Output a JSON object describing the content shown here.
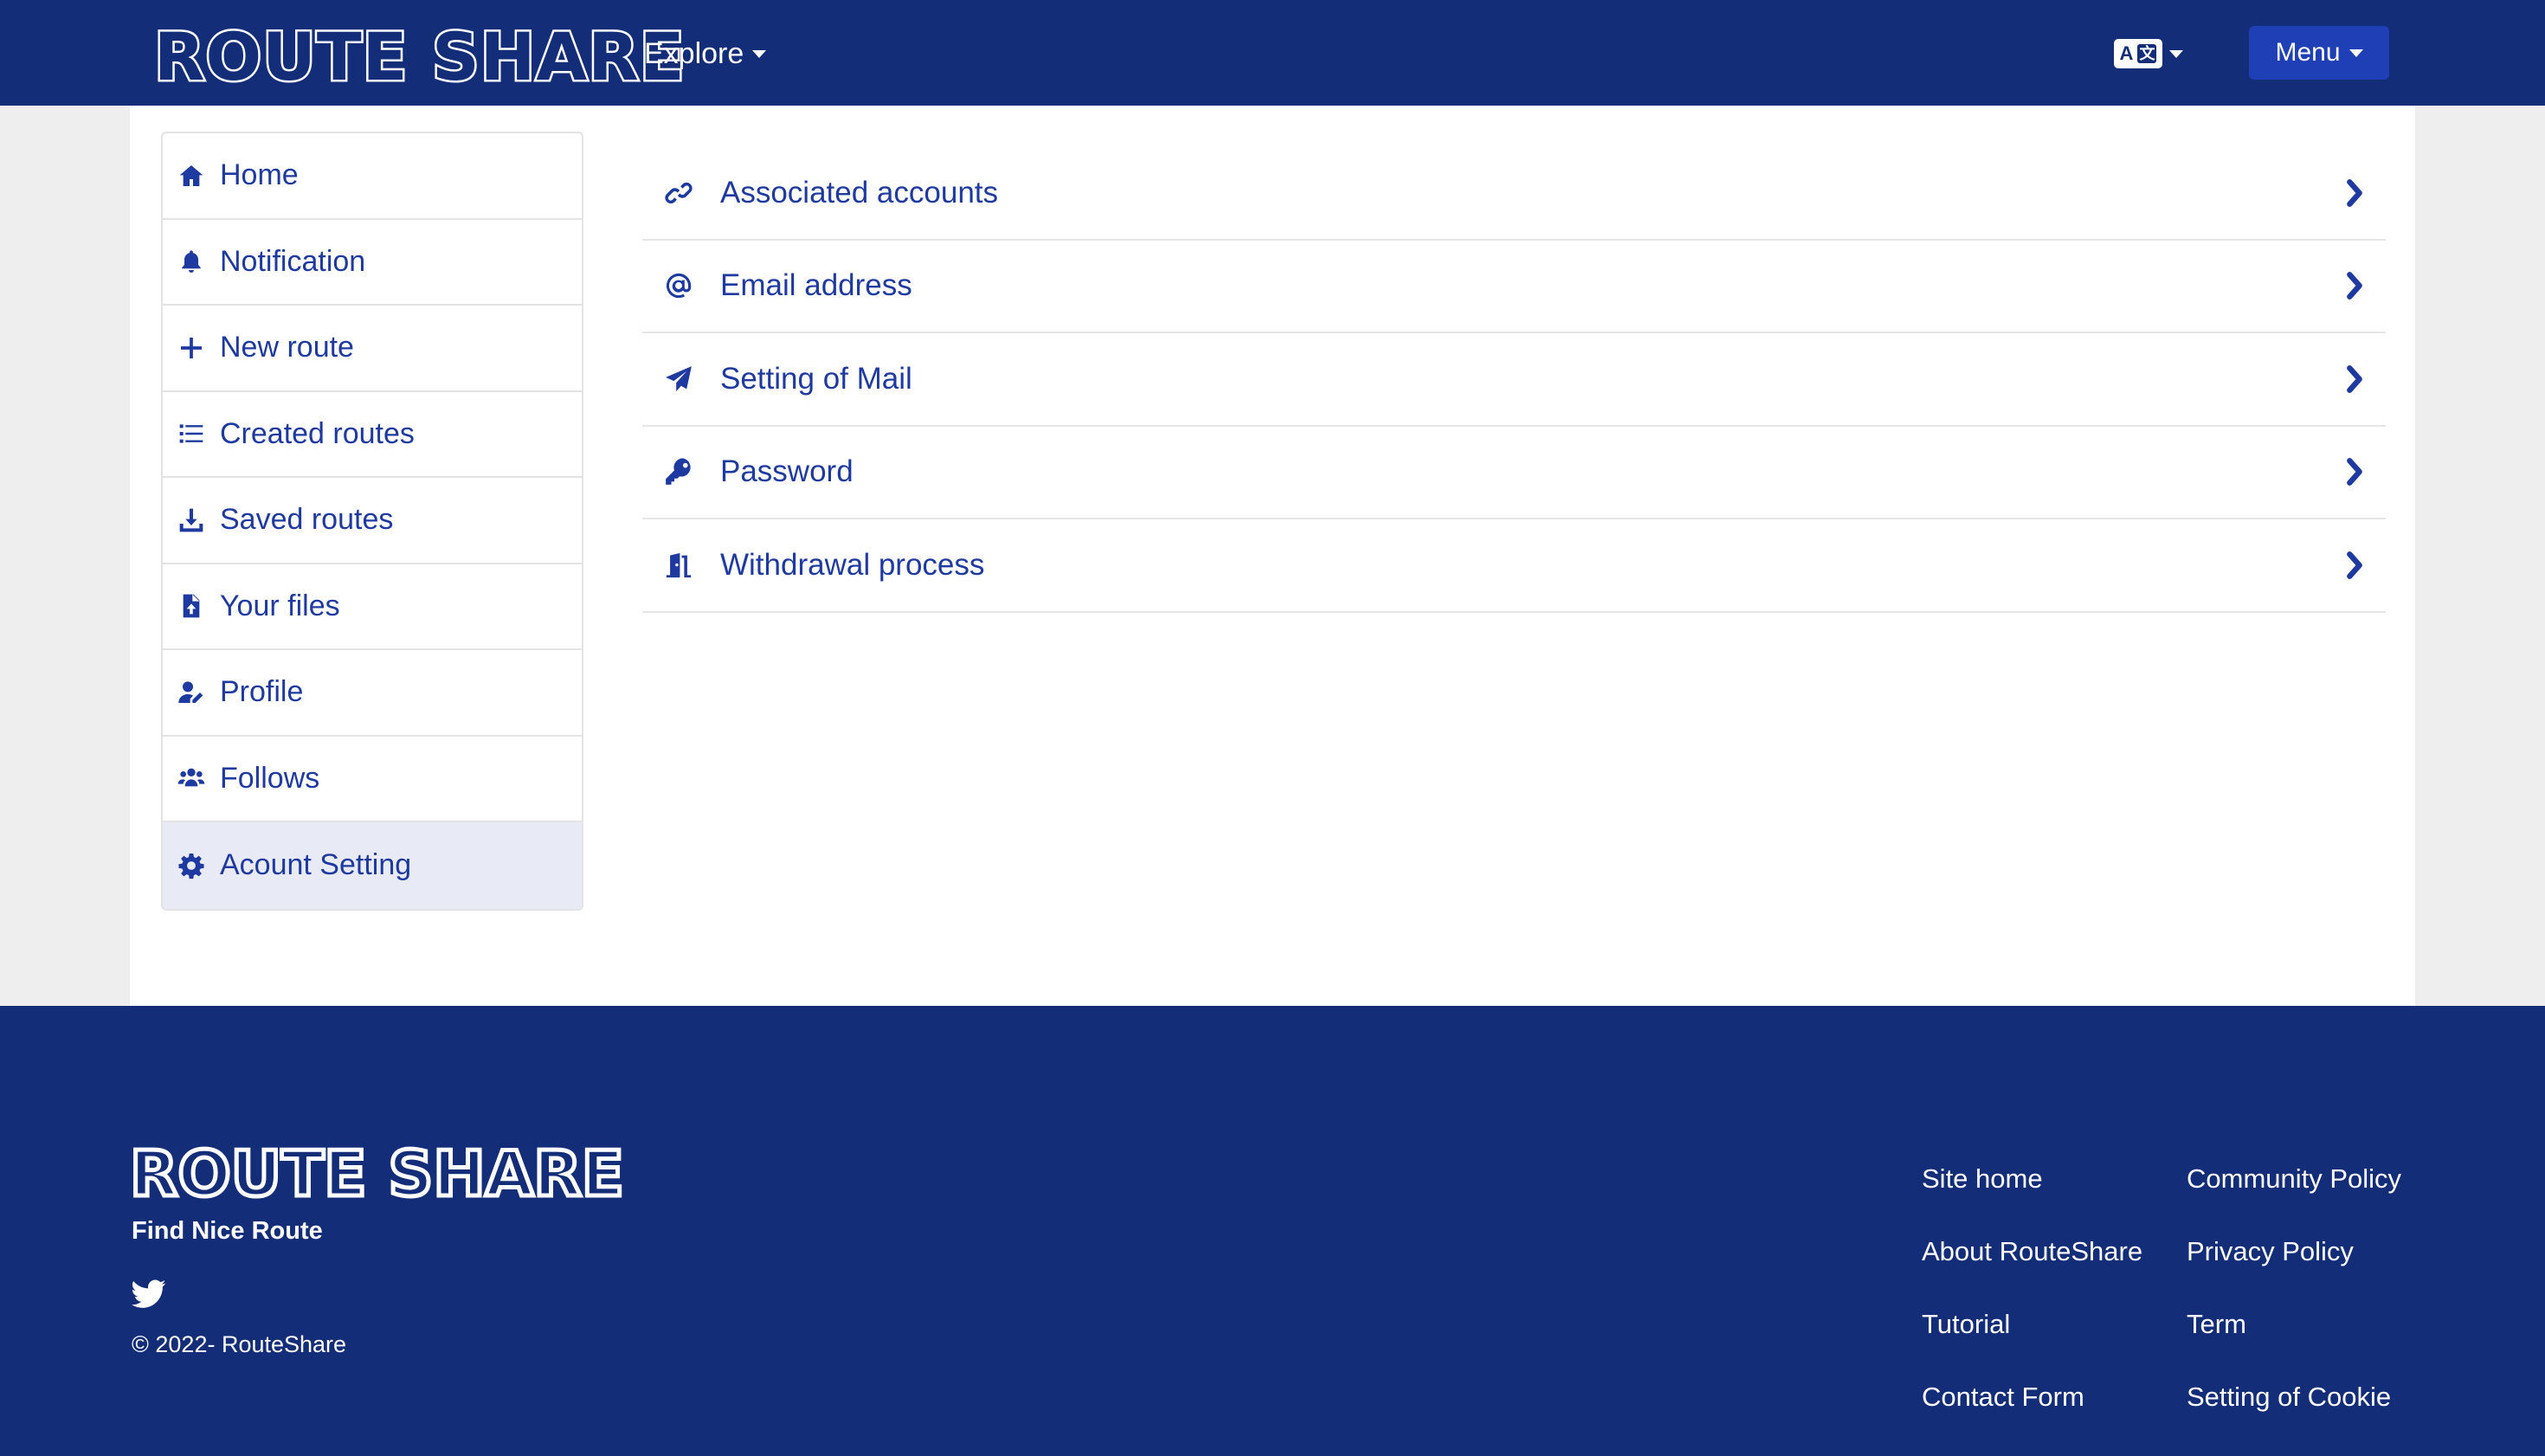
{
  "navbar": {
    "brand": "ROUTE SHARE",
    "explore_label": "Explore",
    "lang_left": "A",
    "lang_right": "文",
    "menu_label": "Menu"
  },
  "sidebar": {
    "items": [
      {
        "label": "Home",
        "icon": "home-icon"
      },
      {
        "label": "Notification",
        "icon": "bell-icon"
      },
      {
        "label": "New route",
        "icon": "plus-icon"
      },
      {
        "label": "Created routes",
        "icon": "list-icon"
      },
      {
        "label": "Saved routes",
        "icon": "download-icon"
      },
      {
        "label": "Your files",
        "icon": "file-upload-icon"
      },
      {
        "label": "Profile",
        "icon": "user-edit-icon"
      },
      {
        "label": "Follows",
        "icon": "users-icon"
      },
      {
        "label": "Acount Setting",
        "icon": "gear-icon",
        "active": true
      }
    ]
  },
  "settings": {
    "items": [
      {
        "label": "Associated accounts",
        "icon": "link-icon"
      },
      {
        "label": "Email address",
        "icon": "at-icon"
      },
      {
        "label": "Setting of Mail",
        "icon": "paper-plane-icon"
      },
      {
        "label": "Password",
        "icon": "key-icon"
      },
      {
        "label": "Withdrawal process",
        "icon": "door-exit-icon"
      }
    ]
  },
  "footer": {
    "brand": "ROUTE SHARE",
    "tagline": "Find Nice Route",
    "copyright": "© 2022- RouteShare",
    "links_col1": [
      "Site home",
      "About RouteShare",
      "Tutorial",
      "Contact Form"
    ],
    "links_col2": [
      "Community Policy",
      "Privacy Policy",
      "Term",
      "Setting of Cookie"
    ]
  },
  "colors": {
    "navy": "#132d78",
    "accent": "#1e3aa0",
    "button": "#1e3fb5",
    "active_bg": "#e8ebf5"
  }
}
